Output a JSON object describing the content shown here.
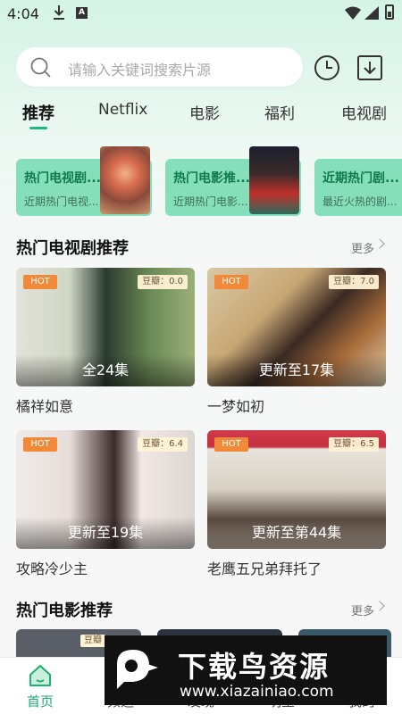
{
  "status_bar": {
    "time": "4:04",
    "a_badge": "A"
  },
  "search": {
    "placeholder": "请输入关键词搜索片源"
  },
  "tabs": [
    "推荐",
    "Netflix",
    "电影",
    "福利",
    "电视剧"
  ],
  "categories": [
    {
      "title": "热门电视剧...",
      "subtitle": "近期热门电视..."
    },
    {
      "title": "热门电影推...",
      "subtitle": "近期热门电影..."
    },
    {
      "title": "近期热门剧...",
      "subtitle": "最近火热的剧..."
    }
  ],
  "tv_section": {
    "title": "热门电视剧推荐",
    "more": "更多",
    "items": [
      {
        "title": "橘祥如意",
        "episodes": "全24集",
        "score": "豆瓣：0.0",
        "hot": "HOT"
      },
      {
        "title": "一梦如初",
        "episodes": "更新至17集",
        "score": "豆瓣：7.0",
        "hot": "HOT"
      },
      {
        "title": "攻略冷少主",
        "episodes": "更新至19集",
        "score": "豆瓣：6.4",
        "hot": "HOT"
      },
      {
        "title": "老鹰五兄弟拜托了",
        "episodes": "更新至第44集",
        "score": "豆瓣：6.5",
        "hot": "HOT"
      }
    ]
  },
  "movie_section": {
    "title": "热门电影推荐",
    "more": "更多",
    "peek_score": "豆瓣"
  },
  "bottom_nav": [
    {
      "label": "首页"
    },
    {
      "label": "频道"
    },
    {
      "label": "发现"
    },
    {
      "label": "明星"
    },
    {
      "label": "我的"
    }
  ],
  "watermark": {
    "name": "下载鸟资源",
    "url": "www.xiazainiao.com"
  },
  "colors": {
    "accent": "#20b97a",
    "category_card": "#86dfbb",
    "hot_badge": "#f08a3a"
  }
}
